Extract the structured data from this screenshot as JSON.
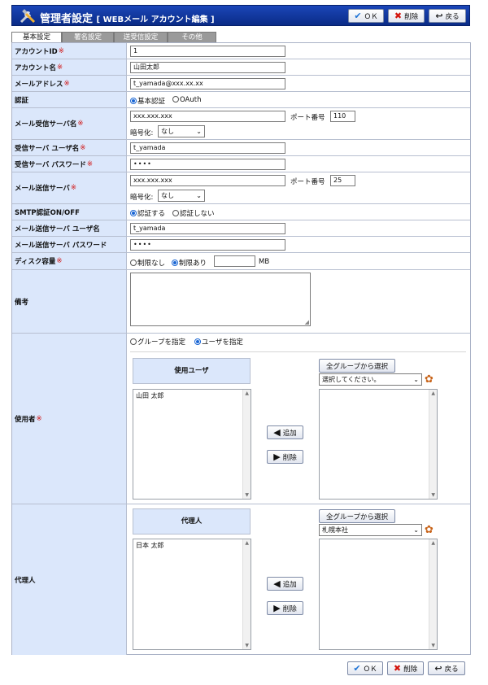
{
  "header": {
    "title": "管理者設定",
    "subtitle": "[ WEBメール アカウント編集 ]"
  },
  "buttons": {
    "ok": "ＯＫ",
    "delete": "削除",
    "back": "戻る"
  },
  "tabs": [
    "基本設定",
    "署名設定",
    "送受信設定",
    "その他"
  ],
  "fields": {
    "account_id": {
      "label": "アカウントID",
      "required": "※",
      "value": "1"
    },
    "account_name": {
      "label": "アカウント名",
      "required": "※",
      "value": "山田太郎"
    },
    "email": {
      "label": "メールアドレス",
      "required": "※",
      "value": "t_yamada@xxx.xx.xx"
    },
    "auth": {
      "label": "認証",
      "options": [
        "基本認証",
        "OAuth"
      ],
      "selected": "基本認証"
    },
    "recv_server": {
      "label": "メール受信サーバ名",
      "required": "※",
      "value": "xxx.xxx.xxx",
      "port_label": "ポート番号",
      "port": "110",
      "enc_label": "暗号化:",
      "enc_value": "なし"
    },
    "recv_user": {
      "label": "受信サーバ ユーザ名",
      "required": "※",
      "value": "t_yamada"
    },
    "recv_password": {
      "label": "受信サーバ パスワード",
      "required": "※",
      "value": "••••"
    },
    "send_server": {
      "label": "メール送信サーバ",
      "required": "※",
      "value": "xxx.xxx.xxx",
      "port_label": "ポート番号",
      "port": "25",
      "enc_label": "暗号化:",
      "enc_value": "なし"
    },
    "smtp_auth": {
      "label": "SMTP認証ON/OFF",
      "options": [
        "認証する",
        "認証しない"
      ],
      "selected": "認証する"
    },
    "send_user": {
      "label": "メール送信サーバ ユーザ名",
      "value": "t_yamada"
    },
    "send_password": {
      "label": "メール送信サーバ パスワード",
      "value": "••••"
    },
    "disk": {
      "label": "ディスク容量",
      "required": "※",
      "options": [
        "制限なし",
        "制限あり"
      ],
      "selected": "制限あり",
      "value": "",
      "unit": "MB"
    },
    "notes": {
      "label": "備考",
      "value": ""
    }
  },
  "users_section": {
    "label": "使用者",
    "required": "※",
    "mode_options": [
      "グループを指定",
      "ユーザを指定"
    ],
    "mode_selected": "ユーザを指定",
    "list_header": "使用ユーザ",
    "list_items": [
      "山田 太郎"
    ],
    "add_label": "追加",
    "remove_label": "削除",
    "select_all_label": "全グループから選択",
    "group_select": "選択してください。",
    "candidates": []
  },
  "proxy_section": {
    "label": "代理人",
    "list_header": "代理人",
    "list_items": [
      "日本 太郎"
    ],
    "add_label": "追加",
    "remove_label": "削除",
    "select_all_label": "全グループから選択",
    "group_select": "札幌本社",
    "candidates": []
  }
}
